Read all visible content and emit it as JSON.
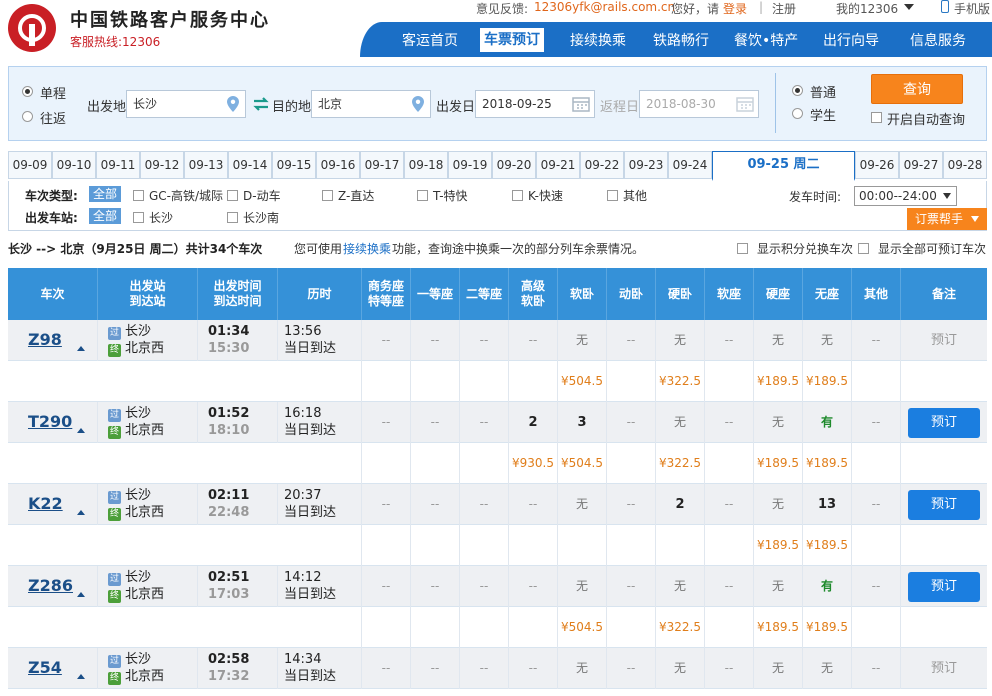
{
  "header": {
    "site_title": "中国铁路客户服务中心",
    "hotline": "客服热线:12306",
    "feedback_label": "意见反馈:",
    "feedback_email": "12306yfk@rails.com.cn",
    "greeting": "您好，请",
    "login": "登录",
    "separator": "|",
    "register": "注册",
    "my12306": "我的12306",
    "mobile": "手机版",
    "nav": [
      "客运首页",
      "车票预订",
      "接续换乘",
      "铁路畅行",
      "餐饮•特产",
      "出行向导",
      "信息服务"
    ]
  },
  "search": {
    "trip_oneway": "单程",
    "trip_round": "往返",
    "from_label": "出发地",
    "from_value": "长沙",
    "to_label": "目的地",
    "to_value": "北京",
    "depart_label": "出发日",
    "depart_value": "2018-09-25",
    "return_label": "返程日",
    "return_value": "2018-08-30",
    "type_normal": "普通",
    "type_student": "学生",
    "query_button": "查询",
    "auto_query": "开启自动查询"
  },
  "dates": {
    "before": [
      "09-09",
      "09-10",
      "09-11",
      "09-12",
      "09-13",
      "09-14",
      "09-15",
      "09-16",
      "09-17",
      "09-18",
      "09-19",
      "09-20",
      "09-21",
      "09-22",
      "09-23",
      "09-24"
    ],
    "active": "09-25 周二",
    "after": [
      "09-26",
      "09-27",
      "09-28"
    ]
  },
  "filters": {
    "type_label": "车次类型:",
    "station_label": "出发车站:",
    "all": "全部",
    "types": [
      "GC-高铁/城际",
      "D-动车",
      "Z-直达",
      "T-特快",
      "K-快速",
      "其他"
    ],
    "stations": [
      "长沙",
      "长沙南"
    ],
    "time_label": "发车时间:",
    "time_value": "00:00--24:00",
    "help_button": "订票帮手"
  },
  "summary": {
    "route": "长沙 --> 北京（9月25日  周二）共计34个车次",
    "tip_prefix": "您可使用",
    "tip_link": "接续换乘",
    "tip_suffix": "功能，查询途中换乘一次的部分列车余票情况。",
    "opt1": "显示积分兑换车次",
    "opt2": "显示全部可预订车次"
  },
  "table": {
    "headers": {
      "train": "车次",
      "station1": "出发站",
      "station2": "到达站",
      "time1": "出发时间",
      "time2": "到达时间",
      "duration": "历时",
      "business1": "商务座",
      "business2": "特等座",
      "first": "一等座",
      "second": "二等座",
      "hsoft1": "高级",
      "hsoft2": "软卧",
      "softsleeper": "软卧",
      "dongwo": "动卧",
      "hardsleeper": "硬卧",
      "softseat": "软座",
      "hardseat": "硬座",
      "noseat": "无座",
      "other": "其他",
      "remark": "备注"
    },
    "badge_pass": "过",
    "badge_end": "终",
    "rows": [
      {
        "code": "Z98",
        "from": "长沙",
        "to": "北京西",
        "dep": "01:34",
        "arr": "15:30",
        "dur": "13:56",
        "arrive_day": "当日到达",
        "seats": [
          "--",
          "--",
          "--",
          "--",
          "无",
          "--",
          "无",
          "--",
          "无",
          "无",
          "--"
        ],
        "prices": [
          "",
          "",
          "",
          "",
          "¥504.5",
          "",
          "¥322.5",
          "",
          "¥189.5",
          "¥189.5",
          ""
        ],
        "book": "预订",
        "bookable": false
      },
      {
        "code": "T290",
        "from": "长沙",
        "to": "北京西",
        "dep": "01:52",
        "arr": "18:10",
        "dur": "16:18",
        "arrive_day": "当日到达",
        "seats": [
          "--",
          "--",
          "--",
          "2",
          "3",
          "--",
          "无",
          "--",
          "无",
          "有",
          "--"
        ],
        "prices": [
          "",
          "",
          "",
          "¥930.5",
          "¥504.5",
          "",
          "¥322.5",
          "",
          "¥189.5",
          "¥189.5",
          ""
        ],
        "book": "预订",
        "bookable": true
      },
      {
        "code": "K22",
        "from": "长沙",
        "to": "北京西",
        "dep": "02:11",
        "arr": "22:48",
        "dur": "20:37",
        "arrive_day": "当日到达",
        "seats": [
          "--",
          "--",
          "--",
          "--",
          "无",
          "--",
          "2",
          "--",
          "无",
          "13",
          "--"
        ],
        "prices": [
          "",
          "",
          "",
          "",
          "",
          "",
          "",
          "",
          "¥189.5",
          "¥189.5",
          ""
        ],
        "book": "预订",
        "bookable": true
      },
      {
        "code": "Z286",
        "from": "长沙",
        "to": "北京西",
        "dep": "02:51",
        "arr": "17:03",
        "dur": "14:12",
        "arrive_day": "当日到达",
        "seats": [
          "--",
          "--",
          "--",
          "--",
          "无",
          "--",
          "无",
          "--",
          "无",
          "有",
          "--"
        ],
        "prices": [
          "",
          "",
          "",
          "",
          "¥504.5",
          "",
          "¥322.5",
          "",
          "¥189.5",
          "¥189.5",
          ""
        ],
        "book": "预订",
        "bookable": true
      },
      {
        "code": "Z54",
        "from": "长沙",
        "to": "北京西",
        "dep": "02:58",
        "arr": "17:32",
        "dur": "14:34",
        "arrive_day": "当日到达",
        "seats": [
          "--",
          "--",
          "--",
          "--",
          "无",
          "--",
          "无",
          "--",
          "无",
          "无",
          "--"
        ],
        "prices": [
          "",
          "",
          "",
          "",
          "",
          "",
          "",
          "",
          "",
          "",
          ""
        ],
        "book": "预订",
        "bookable": false
      }
    ]
  },
  "colors": {
    "brand_blue": "#1b6fc6",
    "header_blue": "#3591d8",
    "orange": "#f7841c",
    "logo_red": "#c91f25"
  }
}
